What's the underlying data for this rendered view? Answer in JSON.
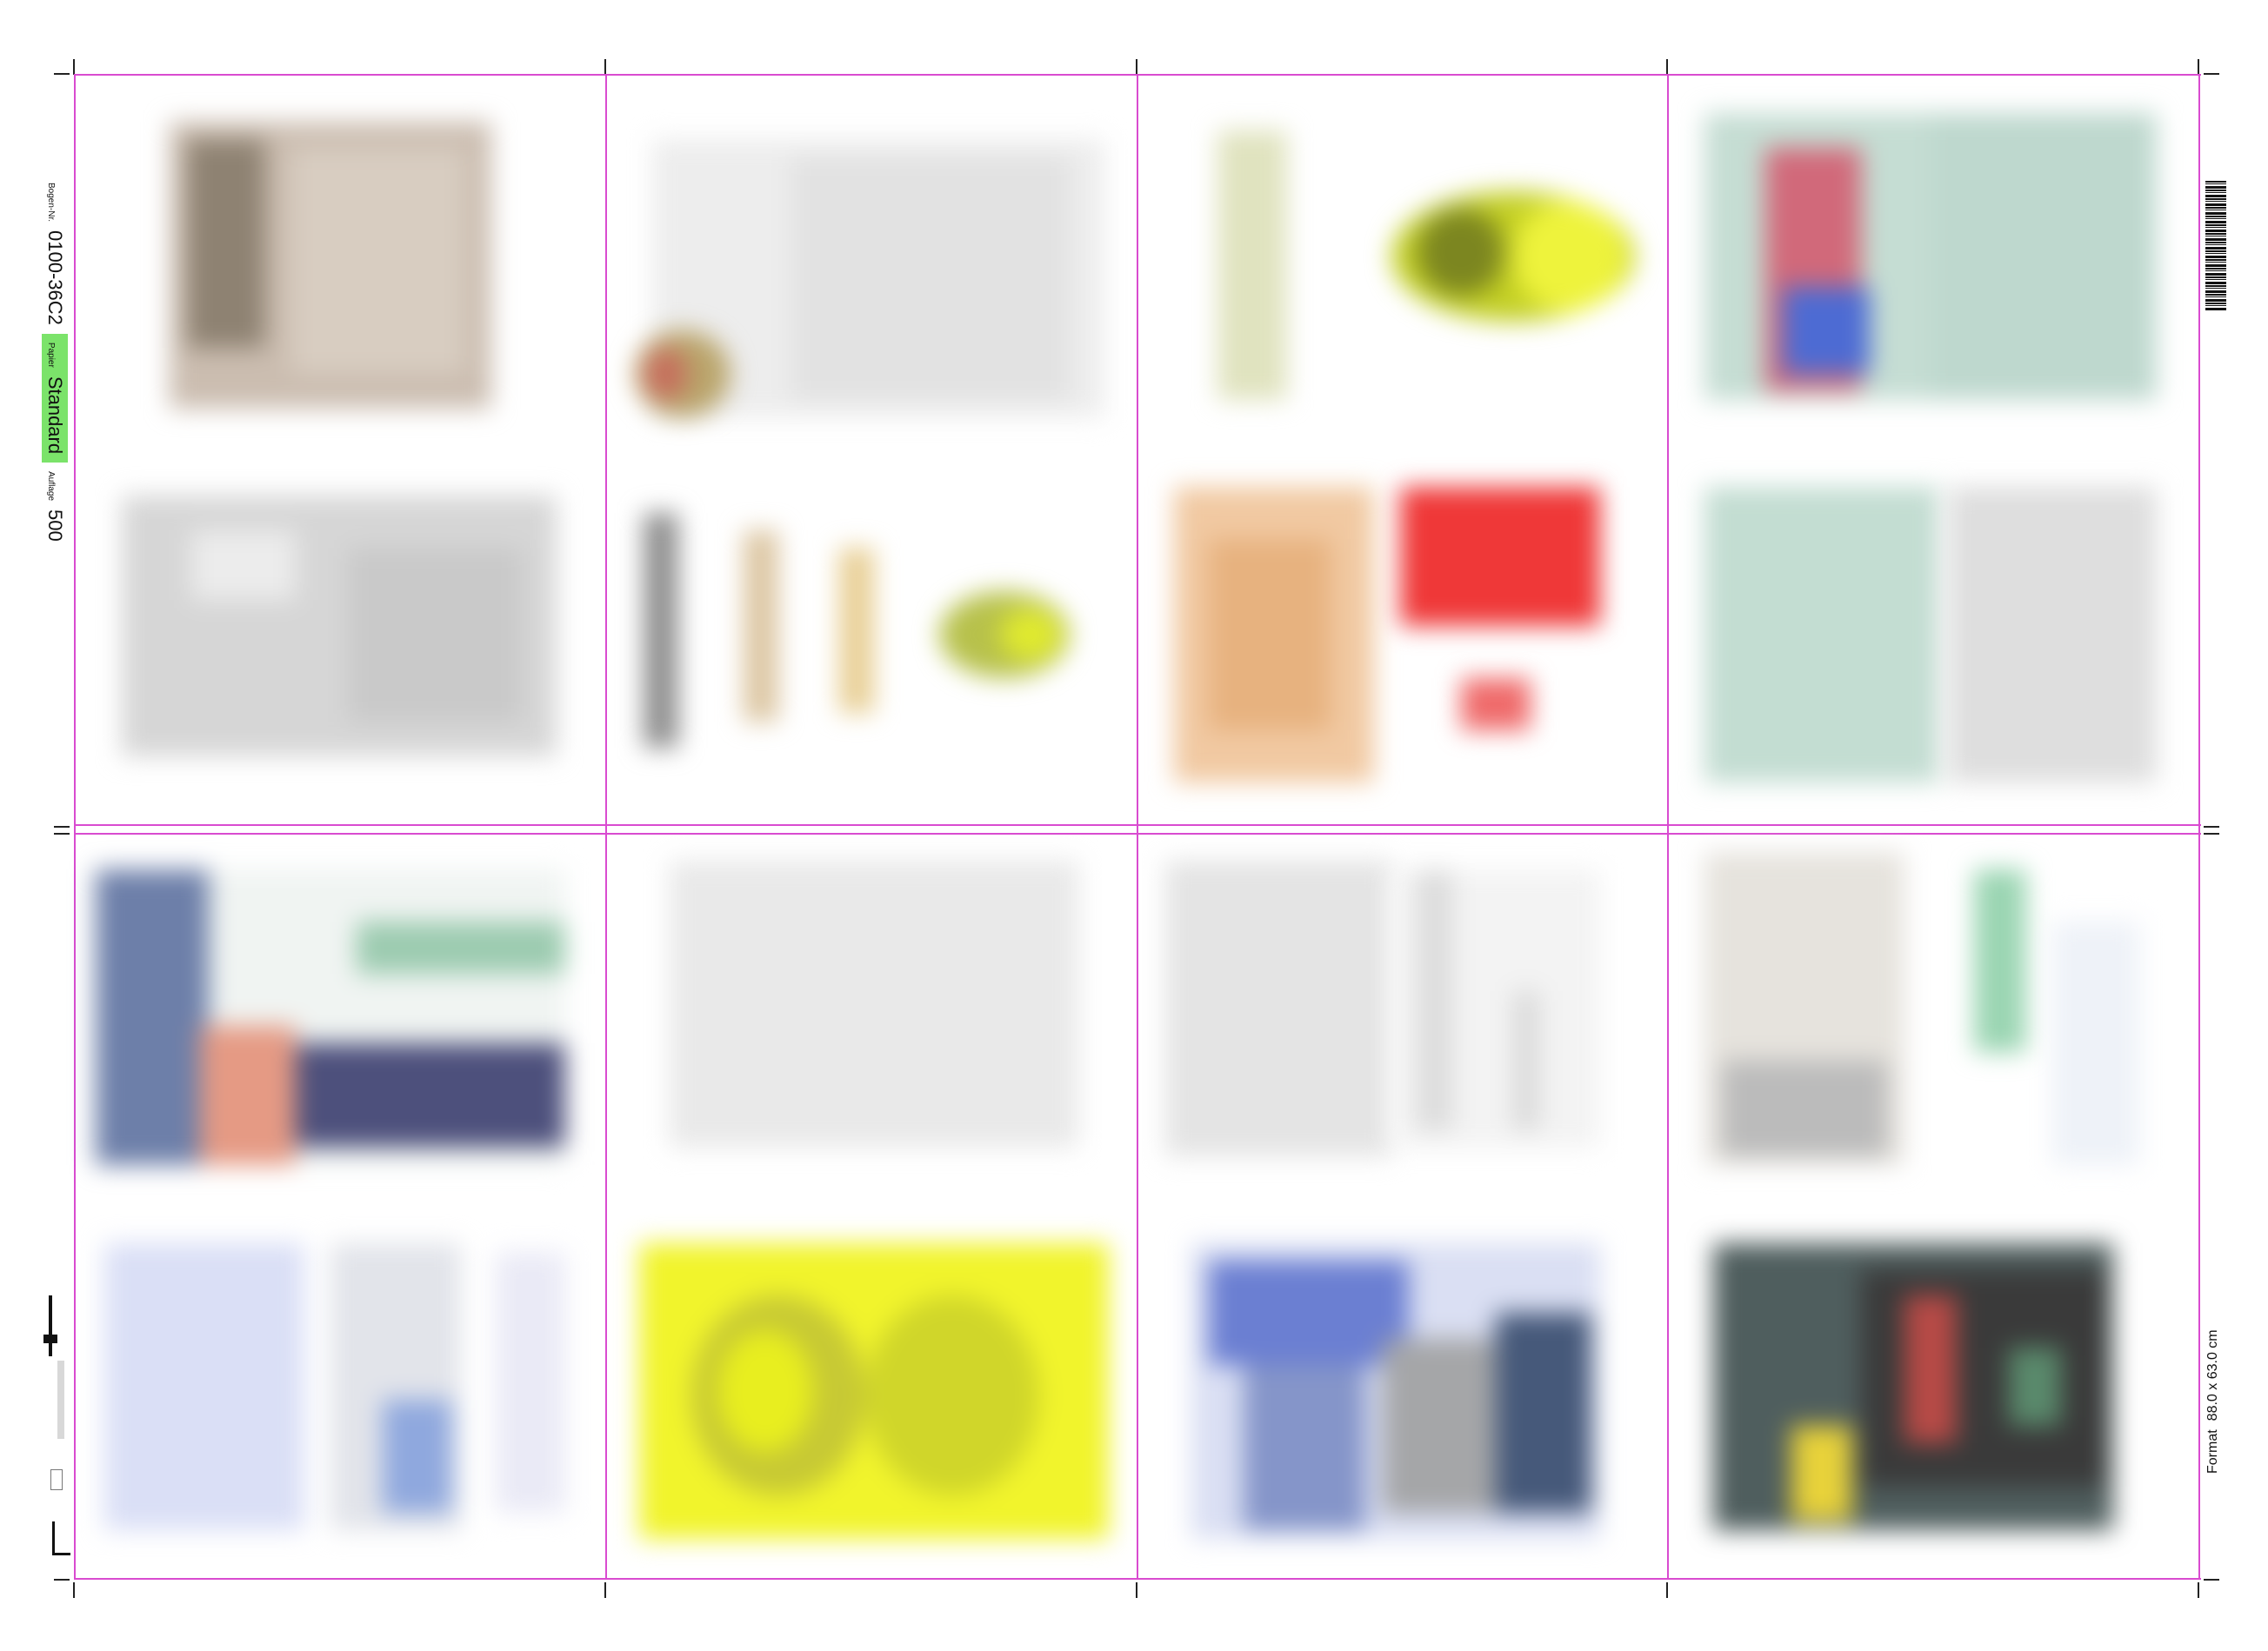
{
  "job": {
    "order_label": "Bogen-Nr.",
    "order_number": "0100-36C2",
    "paper_label": "Papier",
    "paper_value": "Standard",
    "run_label": "Auflage",
    "run_value": "500",
    "format_label": "Format",
    "format_value": "88.0 x 63.0 cm"
  },
  "colors": {
    "panel_line": "#d94bd0",
    "paper_tag": "#7be36a"
  },
  "panels": [
    {
      "name": "panel-1",
      "content": "blurred-page-preview"
    },
    {
      "name": "panel-2",
      "content": "blurred-page-preview"
    },
    {
      "name": "panel-3",
      "content": "blurred-page-preview"
    },
    {
      "name": "panel-4",
      "content": "blurred-page-preview"
    },
    {
      "name": "panel-5",
      "content": "blurred-page-preview"
    },
    {
      "name": "panel-6",
      "content": "blurred-page-preview"
    },
    {
      "name": "panel-7",
      "content": "blurred-page-preview"
    },
    {
      "name": "panel-8",
      "content": "blurred-page-preview"
    }
  ]
}
